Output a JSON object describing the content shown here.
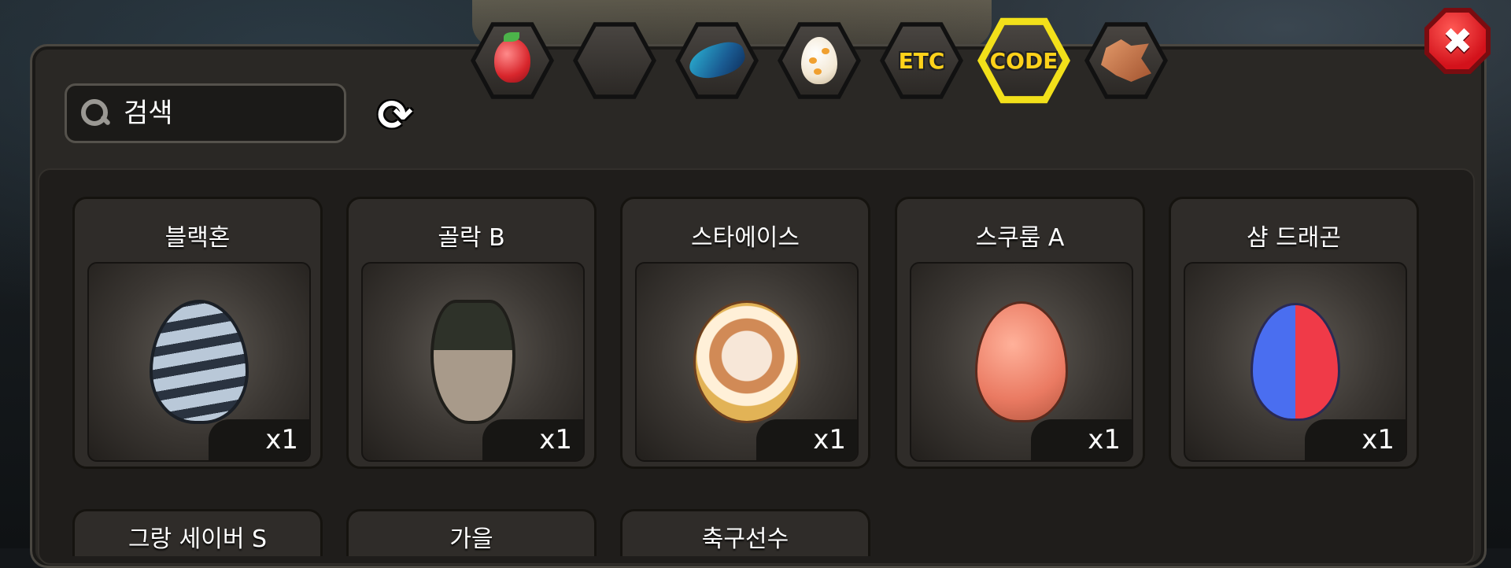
{
  "tabs": [
    {
      "name": "fruit",
      "label": ""
    },
    {
      "name": "gold",
      "label": ""
    },
    {
      "name": "feather",
      "label": ""
    },
    {
      "name": "egg",
      "label": ""
    },
    {
      "name": "etc",
      "label": "ETC"
    },
    {
      "name": "code",
      "label": "CODE",
      "active": true
    },
    {
      "name": "dragon",
      "label": ""
    }
  ],
  "search": {
    "placeholder": "검색"
  },
  "items": [
    {
      "name": "블랙혼",
      "qty": "x1"
    },
    {
      "name": "골락 B",
      "qty": "x1"
    },
    {
      "name": "스타에이스",
      "qty": "x1"
    },
    {
      "name": "스쿠룸 A",
      "qty": "x1"
    },
    {
      "name": "샴 드래곤",
      "qty": "x1"
    }
  ],
  "items_row2": [
    {
      "name": "그랑 세이버 S"
    },
    {
      "name": "가을"
    },
    {
      "name": "축구선수"
    }
  ],
  "colors": {
    "active_tab": "#f2e01a",
    "close": "#d3121b",
    "panel": "#2a2825"
  }
}
